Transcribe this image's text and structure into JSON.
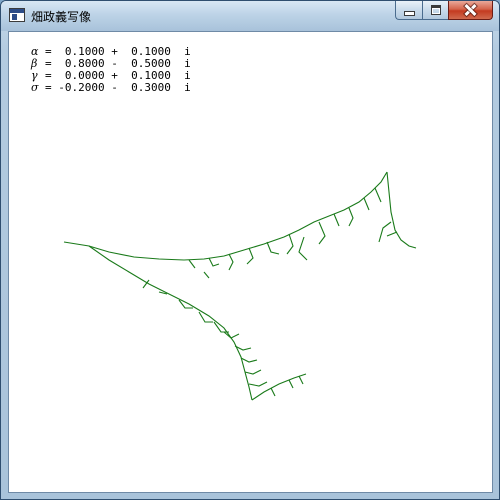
{
  "window": {
    "title": "畑政義写像",
    "icon": "app-window-icon"
  },
  "caption_buttons": {
    "minimize": "minimize-icon",
    "maximize": "maximize-icon",
    "close": "close-icon"
  },
  "params": [
    {
      "symbol": "α",
      "text": "=  0.1000 +  0.1000  i"
    },
    {
      "symbol": "β",
      "text": "=  0.8000 -  0.5000  i"
    },
    {
      "symbol": "γ",
      "text": "=  0.0000 +  0.1000  i"
    },
    {
      "symbol": "σ",
      "text": "= -0.2000 -  0.3000  i"
    }
  ],
  "colors": {
    "fractal": "#1a7a1a",
    "background": "#ffffff"
  }
}
